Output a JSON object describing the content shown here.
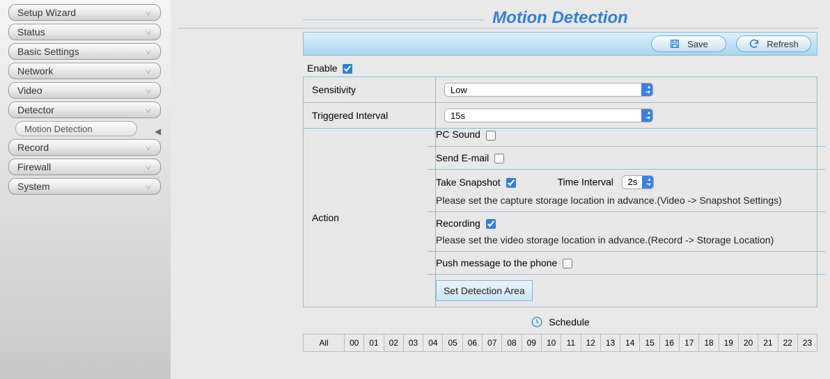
{
  "sidebar": {
    "items": [
      {
        "label": "Setup Wizard"
      },
      {
        "label": "Status"
      },
      {
        "label": "Basic Settings"
      },
      {
        "label": "Network"
      },
      {
        "label": "Video"
      },
      {
        "label": "Detector"
      },
      {
        "label": "Record"
      },
      {
        "label": "Firewall"
      },
      {
        "label": "System"
      }
    ],
    "sub_item": "Motion Detection"
  },
  "page": {
    "title": "Motion Detection"
  },
  "toolbar": {
    "save": "Save",
    "refresh": "Refresh"
  },
  "form": {
    "enable_label": "Enable",
    "enable_checked": true,
    "sensitivity_label": "Sensitivity",
    "sensitivity_value": "Low",
    "interval_label": "Triggered Interval",
    "interval_value": "15s",
    "action_label": "Action",
    "pc_sound_label": "PC Sound",
    "send_email_label": "Send E-mail",
    "take_snapshot_label": "Take Snapshot",
    "take_snapshot_checked": true,
    "time_interval_label": "Time Interval",
    "time_interval_value": "2s",
    "snapshot_hint": "Please set the capture storage location in advance.(Video -> Snapshot Settings)",
    "recording_label": "Recording",
    "recording_checked": true,
    "recording_hint": "Please set the video storage location in advance.(Record -> Storage Location)",
    "push_label": "Push message to the phone",
    "set_area_btn": "Set Detection Area"
  },
  "schedule": {
    "label": "Schedule",
    "all": "All",
    "hours": [
      "00",
      "01",
      "02",
      "03",
      "04",
      "05",
      "06",
      "07",
      "08",
      "09",
      "10",
      "11",
      "12",
      "13",
      "14",
      "15",
      "16",
      "17",
      "18",
      "19",
      "20",
      "21",
      "22",
      "23"
    ]
  }
}
